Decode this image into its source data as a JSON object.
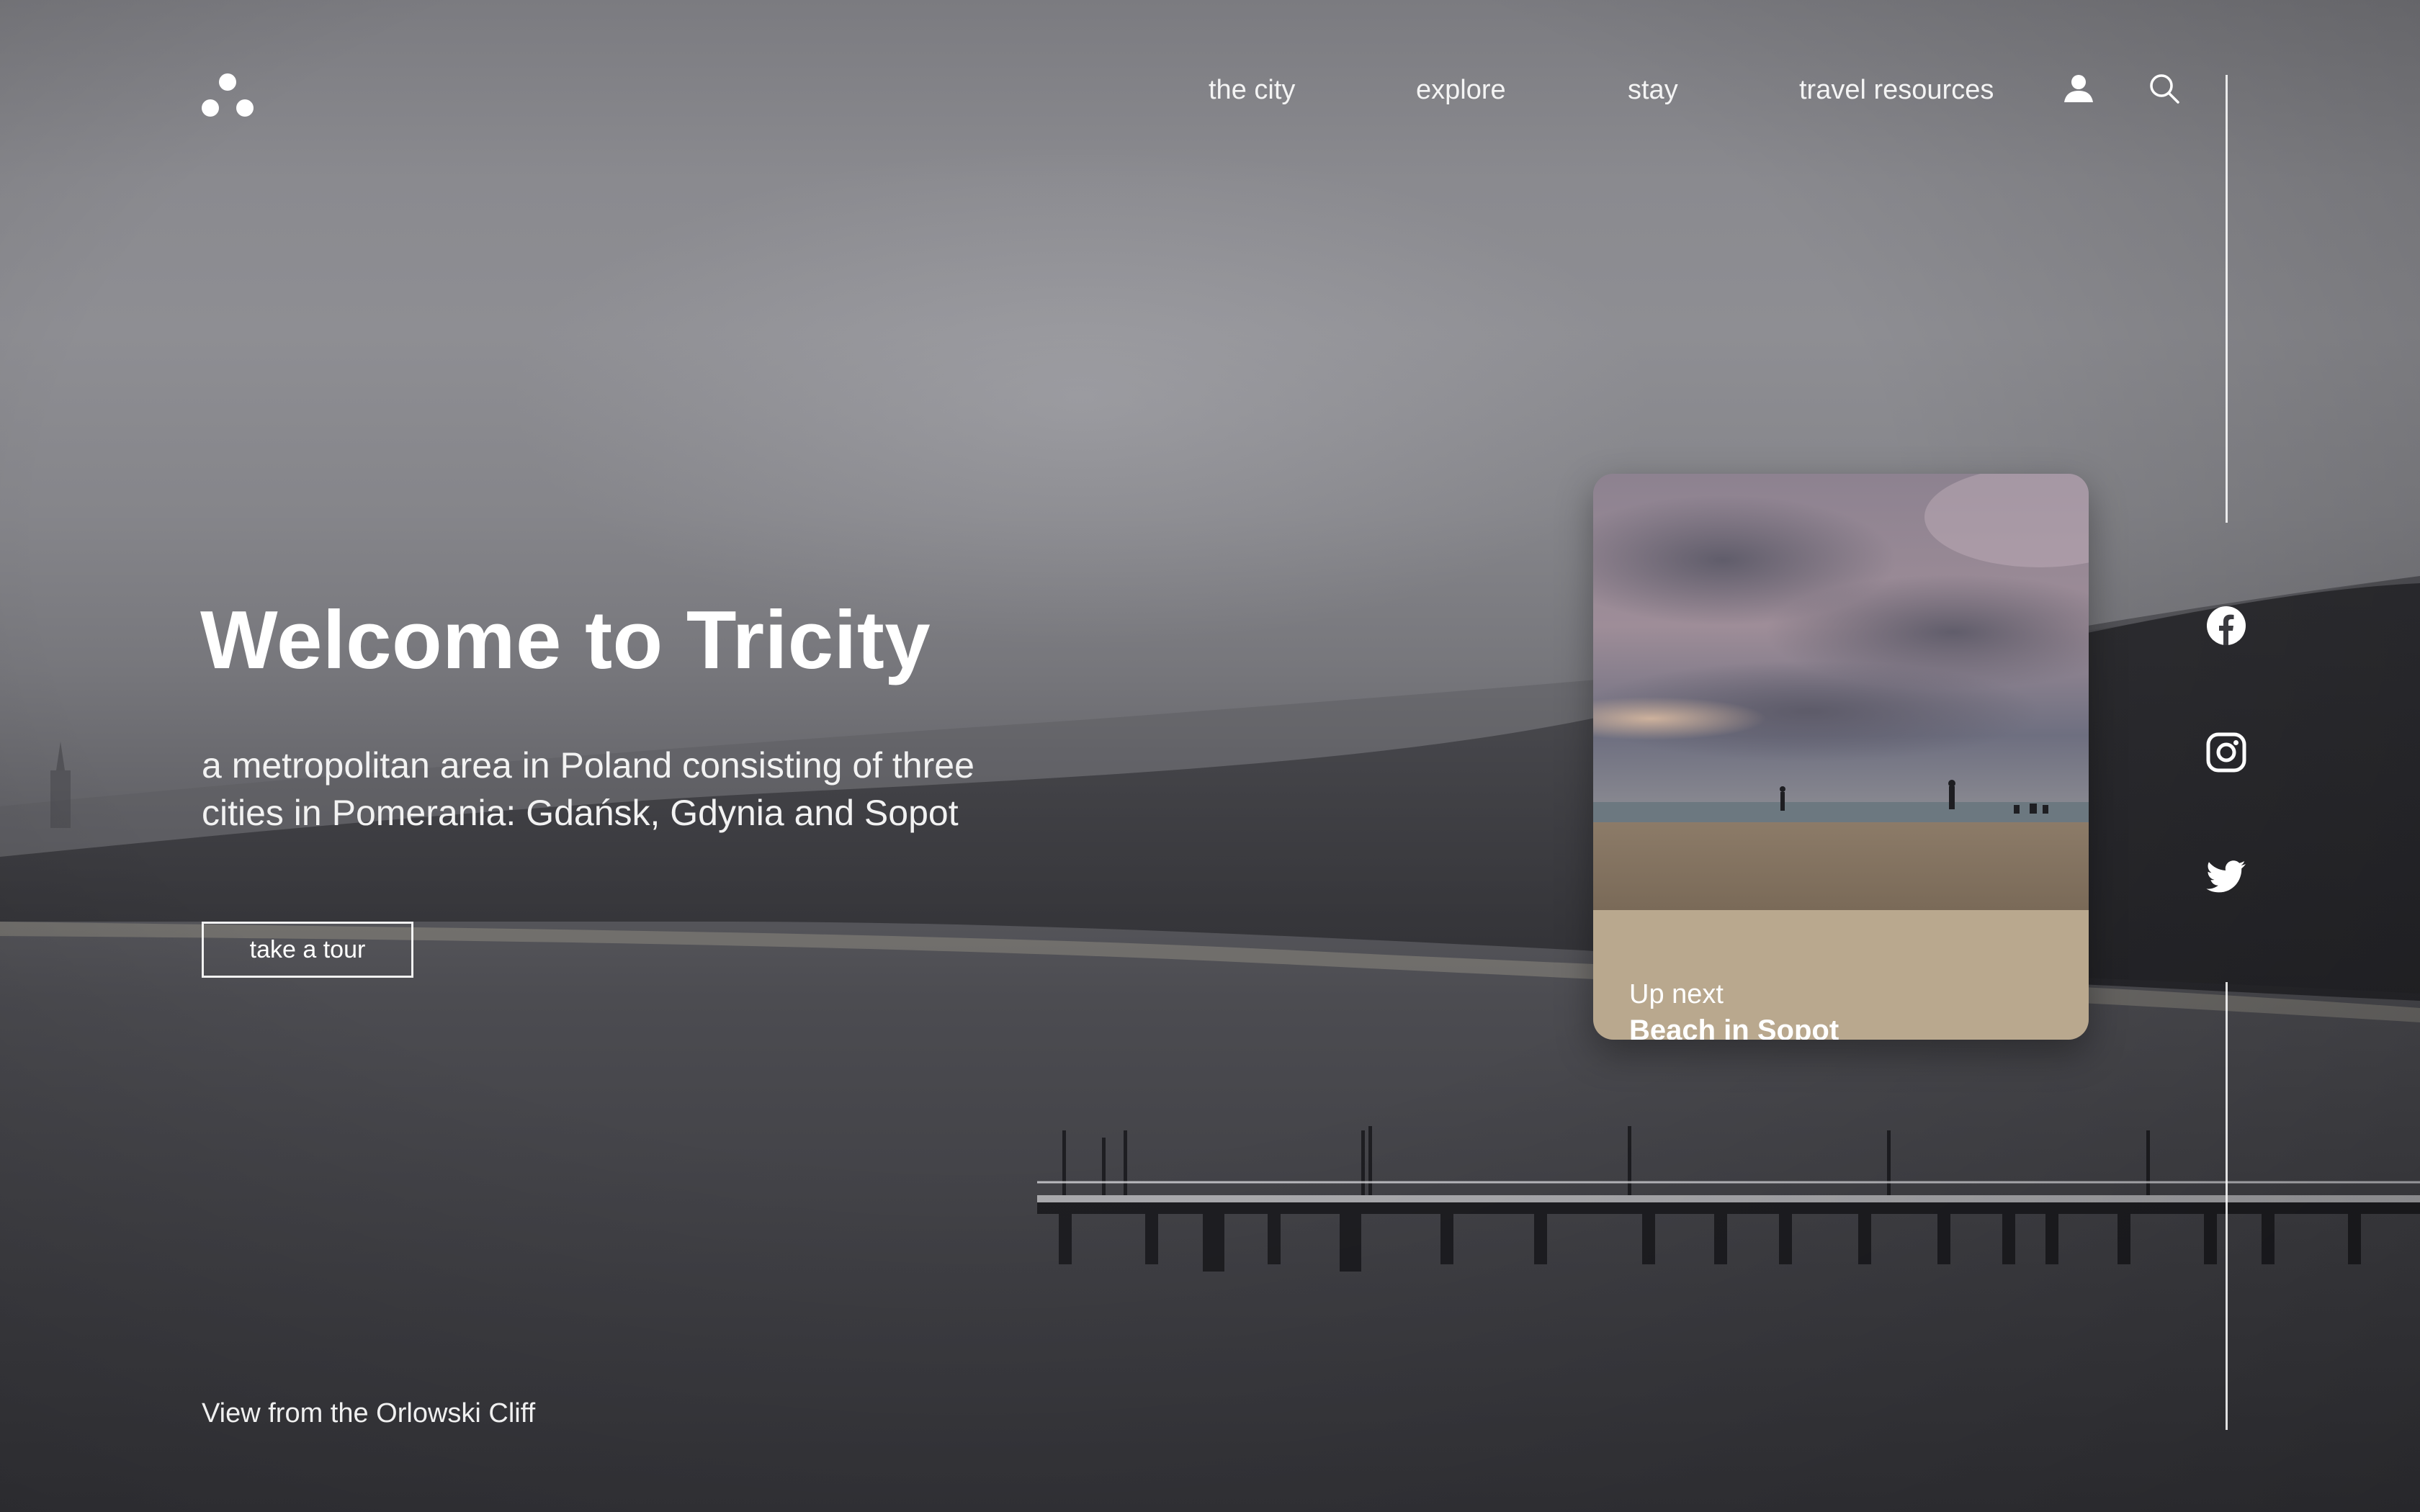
{
  "nav": {
    "items": [
      {
        "label": "the city"
      },
      {
        "label": "explore"
      },
      {
        "label": "stay"
      },
      {
        "label": "travel resources"
      }
    ],
    "user_icon": "user-icon",
    "search_icon": "search-icon"
  },
  "hero": {
    "title": "Welcome to Tricity",
    "subtitle": "a metropolitan area in Poland consisting of three cities in Pomerania: Gdańsk, Gdynia and Sopot",
    "cta_label": "take a tour",
    "caption": "View from the Orlowski Cliff"
  },
  "up_next": {
    "kicker": "Up next",
    "title": "Beach in Sopot",
    "footer_color": "#b9a88e"
  },
  "social": {
    "icons": [
      "facebook-icon",
      "instagram-icon",
      "twitter-icon"
    ]
  },
  "colors": {
    "text": "#ffffff",
    "card_footer": "#b9a88e"
  }
}
